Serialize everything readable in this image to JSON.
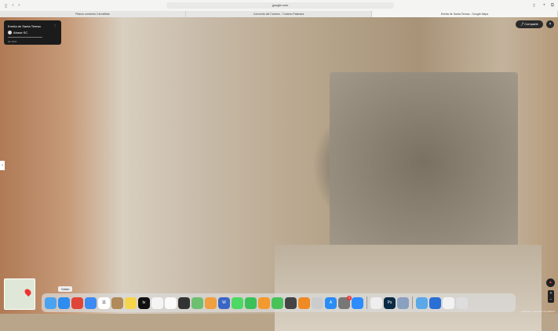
{
  "browser": {
    "url": "google.com",
    "tabs": [
      {
        "label": "Planos convento Carmelitas"
      },
      {
        "label": "Convento del Carmen - Turismo Pastrana"
      },
      {
        "label": "Ermita de Santa Teresa - Google Maps",
        "active": true
      }
    ]
  },
  "card": {
    "title": "Ermita de Santa Teresa",
    "author": "Atrase SC",
    "date": "dic 2022"
  },
  "controls": {
    "share": "Compartir",
    "close": "×",
    "zoom_in": "+",
    "zoom_out": "−"
  },
  "dock": {
    "tooltip": "Safari",
    "apps": [
      {
        "name": "finder",
        "color": "#4aa3f0"
      },
      {
        "name": "safari",
        "color": "#2d8cf0"
      },
      {
        "name": "chrome",
        "color": "#e0453a"
      },
      {
        "name": "mail",
        "color": "#3d8bf2"
      },
      {
        "name": "calendar",
        "color": "#ffffff",
        "text": "11"
      },
      {
        "name": "contacts",
        "color": "#b08a5a"
      },
      {
        "name": "notes",
        "color": "#f7d54a"
      },
      {
        "name": "tv",
        "color": "#111111",
        "text": "tv"
      },
      {
        "name": "freeform",
        "color": "#f4f4f4"
      },
      {
        "name": "reminders",
        "color": "#fafafa"
      },
      {
        "name": "screenshot",
        "color": "#333333"
      },
      {
        "name": "maps",
        "color": "#6cc070"
      },
      {
        "name": "photos",
        "color": "#f0a040"
      },
      {
        "name": "wordpress",
        "color": "#3a66c4",
        "text": "W"
      },
      {
        "name": "messages",
        "color": "#4cd964"
      },
      {
        "name": "facetime",
        "color": "#3cc15a"
      },
      {
        "name": "pages",
        "color": "#f29a2e"
      },
      {
        "name": "numbers",
        "color": "#48c35a"
      },
      {
        "name": "calculator",
        "color": "#444444"
      },
      {
        "name": "books",
        "color": "#f08a24"
      },
      {
        "name": "restrictions",
        "color": "#cccccc"
      },
      {
        "name": "app-store",
        "color": "#2a8cf5",
        "text": "A"
      },
      {
        "name": "system-settings",
        "color": "#777777",
        "badge": "3"
      },
      {
        "name": "zoom",
        "color": "#2d8cff"
      },
      {
        "sep": true
      },
      {
        "name": "textedit",
        "color": "#eeeeee"
      },
      {
        "name": "photoshop",
        "color": "#0b2a45",
        "text": "Ps"
      },
      {
        "name": "preview",
        "color": "#8aa0c0"
      },
      {
        "sep": true
      },
      {
        "name": "downloads-folder",
        "color": "#5aa8e8"
      },
      {
        "name": "network",
        "color": "#2a6fd6"
      },
      {
        "name": "drive",
        "color": "#f2f2f2"
      },
      {
        "name": "trash",
        "color": "#dddddd"
      }
    ]
  },
  "footer": "Condiciones · Informar de un problema"
}
